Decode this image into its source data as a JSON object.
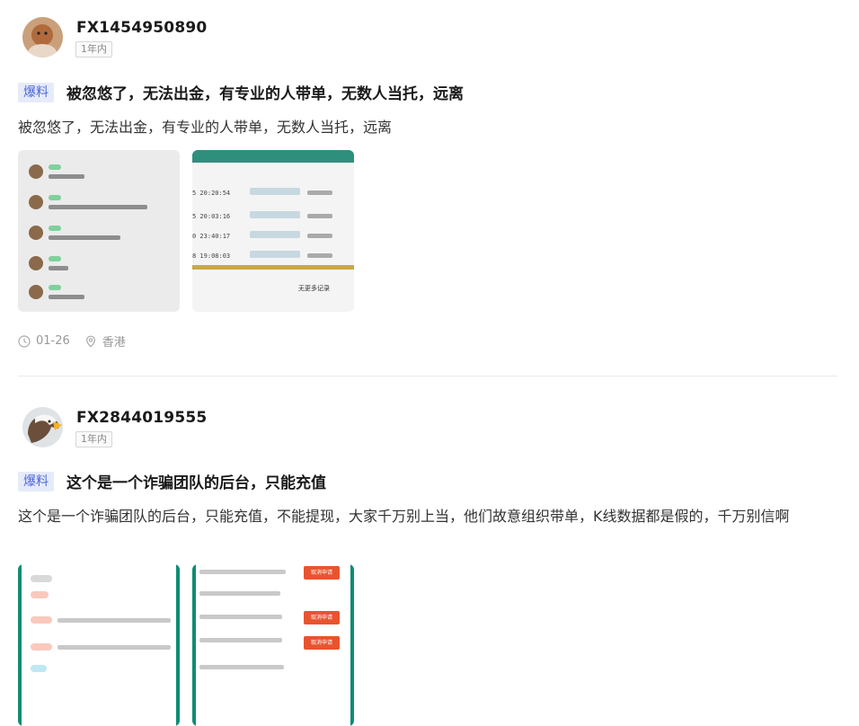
{
  "posts": [
    {
      "username": "FX1454950890",
      "time_badge": "1年内",
      "tag": "爆料",
      "title": "被忽悠了，无法出金，有专业的人带单，无数人当托，远离",
      "body": "被忽悠了，无法出金，有专业的人带单，无数人当托，远离",
      "date": "01-26",
      "location": "香港",
      "thumbnails": [
        "chat-screenshot",
        "record-table-screenshot"
      ],
      "table_rows": [
        "5 20:20:54",
        "5 20:03:16",
        "0 23:40:17",
        "8 19:08:03"
      ],
      "table_more": "无更多记录"
    },
    {
      "username": "FX2844019555",
      "time_badge": "1年内",
      "tag": "爆料",
      "title": "这个是一个诈骗团队的后台，只能充值",
      "body": "这个是一个诈骗团队的后台，只能充值，不能提现，大家千万别上当，他们故意组织带单，K线数据都是假的，千万别信啊",
      "thumbnails": [
        "admin-screenshot",
        "withdraw-screenshot"
      ],
      "button_label": "取消申请"
    }
  ],
  "colors": {
    "tag_bg": "#e6ebfa",
    "tag_text": "#4c67d8",
    "accent_green": "#0f8c74",
    "button_red": "#e8542e"
  },
  "icons": [
    "clock-icon",
    "location-pin-icon"
  ]
}
